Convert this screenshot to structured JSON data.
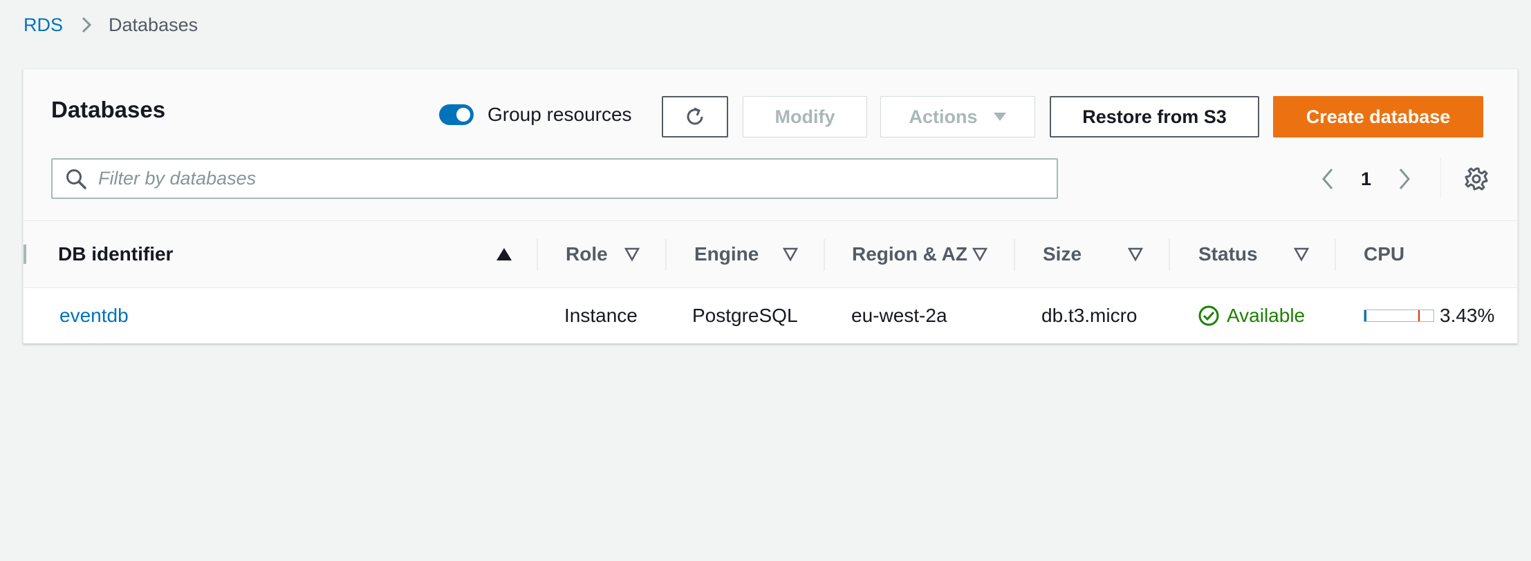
{
  "breadcrumb": {
    "root": "RDS",
    "current": "Databases"
  },
  "panel": {
    "title": "Databases",
    "group_toggle": {
      "label": "Group resources",
      "on": true
    },
    "buttons": {
      "modify": "Modify",
      "actions": "Actions",
      "restore": "Restore from S3",
      "create": "Create database"
    },
    "search": {
      "placeholder": "Filter by databases",
      "value": ""
    },
    "pagination": {
      "current_page": "1"
    }
  },
  "table": {
    "columns": [
      {
        "label": "DB identifier",
        "sort": "ascending"
      },
      {
        "label": "Role",
        "sort": "none"
      },
      {
        "label": "Engine",
        "sort": "none"
      },
      {
        "label": "Region & AZ",
        "sort": "none"
      },
      {
        "label": "Size",
        "sort": "none"
      },
      {
        "label": "Status",
        "sort": "none"
      },
      {
        "label": "CPU",
        "sort": "none"
      }
    ],
    "rows": [
      {
        "identifier": "eventdb",
        "role": "Instance",
        "engine": "PostgreSQL",
        "region": "eu-west-2a",
        "size": "db.t3.micro",
        "status": "Available",
        "cpu": "3.43%",
        "cpu_fraction": 0.0343
      }
    ]
  },
  "colors": {
    "link": "#0073bb",
    "primary": "#ec7211",
    "status_ok": "#1d8102",
    "background": "#f2f3f3"
  },
  "icons": [
    "chevron-right-icon",
    "refresh-icon",
    "caret-down-icon",
    "search-icon",
    "chevron-left-icon",
    "gear-icon",
    "sort-ascending-icon",
    "sort-icon",
    "check-circle-icon"
  ]
}
